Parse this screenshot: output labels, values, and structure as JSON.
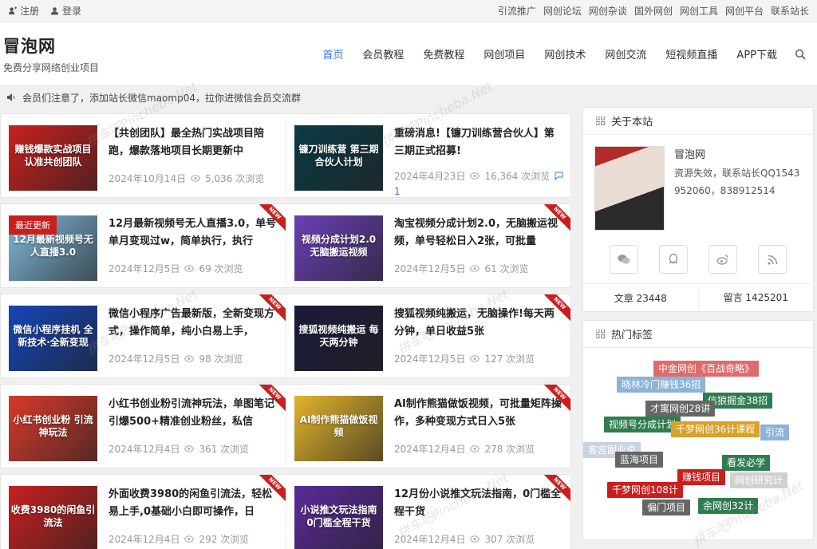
{
  "topbar": {
    "register": "注册",
    "login": "登录",
    "links": [
      "引流推广",
      "网创论坛",
      "网创杂谈",
      "国外网创",
      "网创工具",
      "网创平台",
      "联系站长"
    ]
  },
  "header": {
    "site_name": "冒泡网",
    "slogan": "免费分享网络创业项目",
    "nav": [
      "首页",
      "会员教程",
      "免费教程",
      "网创项目",
      "网创技术",
      "网创交流",
      "短视频直播",
      "APP下载"
    ]
  },
  "notice": "会员们注意了，添加站长微信maomp04，拉你进微信会员交流群",
  "posts": [
    {
      "title": "【共创团队】最全热门实战项目陪跑，爆款落地项目长期更新中",
      "date": "2024年10月14日",
      "views": "5,036 次浏览",
      "thumb_text": "赚钱爆款实战项目 认准共创团队",
      "thumb_color": "#c9201f",
      "new": false,
      "latest": false,
      "comments": ""
    },
    {
      "title": "重磅消息!【镰刀训练营合伙人】第三期正式招募!",
      "date": "2024年4月23日",
      "views": "16,364 次浏览",
      "thumb_text": "镰刀训练营 第三期合伙人计划",
      "thumb_color": "#0b3a45",
      "new": false,
      "latest": false,
      "comments": "1"
    },
    {
      "title": "12月最新视频号无人直播3.0，单号单月变现过w，简单执行，执行",
      "date": "2024年12月5日",
      "views": "69 次浏览",
      "thumb_text": "12月最新视频号无人直播3.0",
      "thumb_color": "#7fb8d9",
      "new": true,
      "latest": true,
      "latest_label": "最近更新",
      "comments": ""
    },
    {
      "title": "淘宝视频分成计划2.0，无脑搬运视频，单号轻松日入2张，可批量",
      "date": "2024年12月5日",
      "views": "61 次浏览",
      "thumb_text": "视频分成计划2.0 无脑搬运视频",
      "thumb_color": "#6a3fb5",
      "new": true,
      "latest": false,
      "comments": ""
    },
    {
      "title": "微信小程序广告最新版，全新变现方式，操作简单，纯小白易上手，",
      "date": "2024年12月5日",
      "views": "98 次浏览",
      "thumb_text": "微信小程序挂机 全新技术·全新变现",
      "thumb_color": "#1545b8",
      "new": true,
      "latest": false,
      "comments": ""
    },
    {
      "title": "搜狐视频纯搬运，无脑操作!每天两分钟，单日收益5张",
      "date": "2024年12月5日",
      "views": "127 次浏览",
      "thumb_text": "搜狐视频纯搬运 每天两分钟",
      "thumb_color": "#1a1a3a",
      "new": true,
      "latest": false,
      "comments": ""
    },
    {
      "title": "小红书创业粉引流神玩法，单图笔记引爆500+精准创业粉丝，私信",
      "date": "2024年12月4日",
      "views": "361 次浏览",
      "thumb_text": "小红书创业粉 引流神玩法",
      "thumb_color": "#d83a2a",
      "new": true,
      "latest": false,
      "comments": ""
    },
    {
      "title": "AI制作熊猫做饭视频，可批量矩阵操作，多种变现方式日入5张",
      "date": "2024年12月4日",
      "views": "278 次浏览",
      "thumb_text": "AI制作熊猫做饭视频",
      "thumb_color": "#e2b32a",
      "new": true,
      "latest": false,
      "comments": ""
    },
    {
      "title": "外面收费3980的闲鱼引流法，轻松易上手,0基础小白即可操作，日",
      "date": "2024年12月4日",
      "views": "292 次浏览",
      "thumb_text": "收费3980的闲鱼引流法",
      "thumb_color": "#c9201f",
      "new": true,
      "latest": false,
      "comments": ""
    },
    {
      "title": "12月份小说推文玩法指南，0门槛全程干货",
      "date": "2024年12月4日",
      "views": "307 次浏览",
      "thumb_text": "小说推文玩法指南 0门槛全程干货",
      "thumb_color": "#5a2a9a",
      "new": true,
      "latest": false,
      "comments": ""
    }
  ],
  "sidebar": {
    "about_title": "关于本站",
    "site_name": "冒泡网",
    "desc": "资源失效，联系站长QQ1543952060，838912514",
    "articles": "文章 23448",
    "comments": "留言 1425201",
    "tags_title": "热门标签",
    "tags": [
      {
        "text": "中金网创《百战奇略》",
        "color": "#e06b6b"
      },
      {
        "text": "晓林冷门赚钱36招",
        "color": "#8cb3d9"
      },
      {
        "text": "信狼掘金38招",
        "color": "#2f7d4f"
      },
      {
        "text": "才寓网创28讲",
        "color": "#666666"
      },
      {
        "text": "视频号分成计划",
        "color": "#2f7d4f"
      },
      {
        "text": "千梦网创36计课程",
        "color": "#d9a12a"
      },
      {
        "text": "引流",
        "color": "#8cb3d9"
      },
      {
        "text": "客宫副业说",
        "color": "#c8d4e0"
      },
      {
        "text": "蓝海项目",
        "color": "#666666"
      },
      {
        "text": "看发必学",
        "color": "#2f7d4f"
      },
      {
        "text": "赚钱项目",
        "color": "#c9201f"
      },
      {
        "text": "网创研究计",
        "color": "#d0d0d0"
      },
      {
        "text": "千梦网创108计",
        "color": "#c9201f"
      },
      {
        "text": "余网创32计",
        "color": "#2f7d4f"
      },
      {
        "text": "偏门项目",
        "color": "#666666"
      }
    ]
  },
  "watermark": "拼车吧Pincheba.Net"
}
